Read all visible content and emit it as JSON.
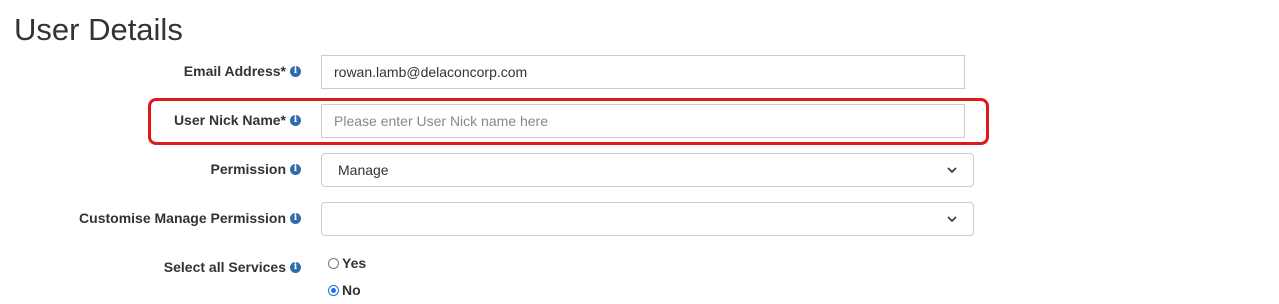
{
  "page": {
    "title": "User Details"
  },
  "form": {
    "email": {
      "label": "Email Address*",
      "value": "rowan.lamb@delaconcorp.com"
    },
    "nickname": {
      "label": "User Nick Name*",
      "value": "",
      "placeholder": "Please enter User Nick name here"
    },
    "permission": {
      "label": "Permission",
      "selected": "Manage"
    },
    "customise_permission": {
      "label": "Customise Manage Permission",
      "selected": ""
    },
    "select_all_services": {
      "label": "Select all Services",
      "options": [
        {
          "label": "Yes",
          "checked": false
        },
        {
          "label": "No",
          "checked": true
        }
      ]
    }
  },
  "icons": {
    "info": "info-icon",
    "dropdown": "chevron-down-icon"
  },
  "colors": {
    "highlight": "#e0181b",
    "info_icon": "#2d6da8",
    "radio_checked": "#1a73e8"
  }
}
